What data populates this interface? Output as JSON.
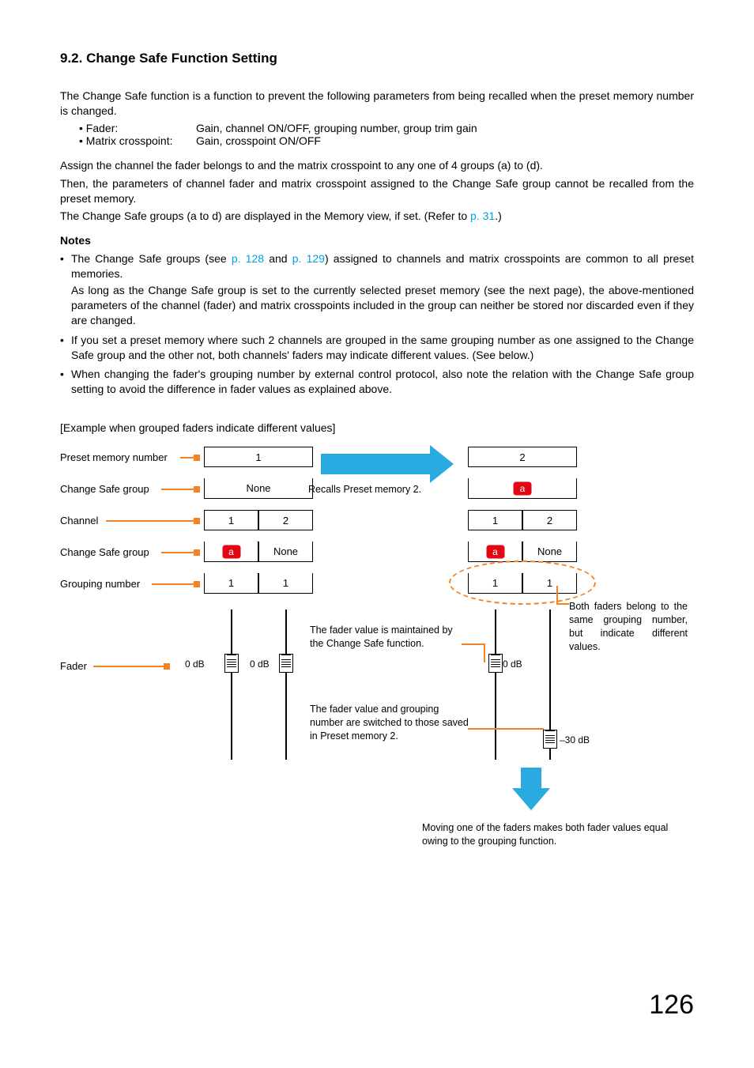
{
  "section": {
    "heading": "9.2. Change Safe Function Setting",
    "intro": "The Change Safe function is a function to prevent the following parameters from being recalled when the preset memory number is changed.",
    "defs": [
      {
        "k": "• Fader:",
        "v": "Gain, channel ON/OFF, grouping number, group trim gain"
      },
      {
        "k": "• Matrix crosspoint:",
        "v": "Gain, crosspoint ON/OFF"
      }
    ],
    "para2a": "Assign the channel the fader belongs to and the matrix crosspoint to any one of 4 groups (a) to (d).",
    "para2b": "Then, the parameters of channel fader and matrix crosspoint assigned to the Change Safe group cannot be recalled from the preset memory.",
    "para2c_pre": "The Change Safe groups (a to d) are displayed in the Memory view, if set. (Refer to ",
    "para2c_link": "p. 31",
    "para2c_post": ".)"
  },
  "notes": {
    "head": "Notes",
    "n1_a": "The Change Safe groups (see ",
    "n1_l1": "p. 128",
    "n1_mid": " and ",
    "n1_l2": "p. 129",
    "n1_b": ") assigned to channels and matrix crosspoints are common to all preset memories.",
    "n1_c": "As long as the Change Safe group is set to the currently selected preset memory (see the next page), the above-mentioned parameters of the channel (fader) and matrix crosspoints included in the group can neither be stored nor discarded even if they are changed.",
    "n2": "If you set a preset memory where such 2 channels are grouped in the same grouping number as one assigned to the Change Safe group and the other not, both channels' faders may indicate different values. (See below.)",
    "n3": "When changing the fader's grouping number by external control protocol, also note the relation with the Change Safe group setting to avoid the difference in fader values as explained above."
  },
  "example": {
    "caption": "[Example when grouped faders indicate different values]",
    "labels": {
      "r1": "Preset memory number",
      "r2": "Change Safe group",
      "r3": "Channel",
      "r4": "Change Safe group",
      "r5": "Grouping number",
      "r6": "Fader"
    },
    "left": {
      "preset": "1",
      "safe_top": "None",
      "ch": [
        "1",
        "2"
      ],
      "safe_ch": [
        "a",
        "None"
      ],
      "grp": [
        "1",
        "1"
      ],
      "fader_vals": [
        "0 dB",
        "0 dB"
      ]
    },
    "right": {
      "preset": "2",
      "safe_top": "a",
      "ch": [
        "1",
        "2"
      ],
      "safe_ch": [
        "a",
        "None"
      ],
      "grp": [
        "1",
        "1"
      ],
      "fader_vals": [
        "0 dB",
        "–30 dB"
      ]
    },
    "recall_text": "Recalls Preset memory 2.",
    "annot1": "The fader value is maintained by the Change Safe function.",
    "annot2": "The fader value and grouping number are switched to those saved in Preset memory 2.",
    "annot3": "Both faders belong to the same grouping number, but indicate different values.",
    "footer": "Moving one of the faders makes both fader values equal owing to the grouping function."
  },
  "page": "126"
}
